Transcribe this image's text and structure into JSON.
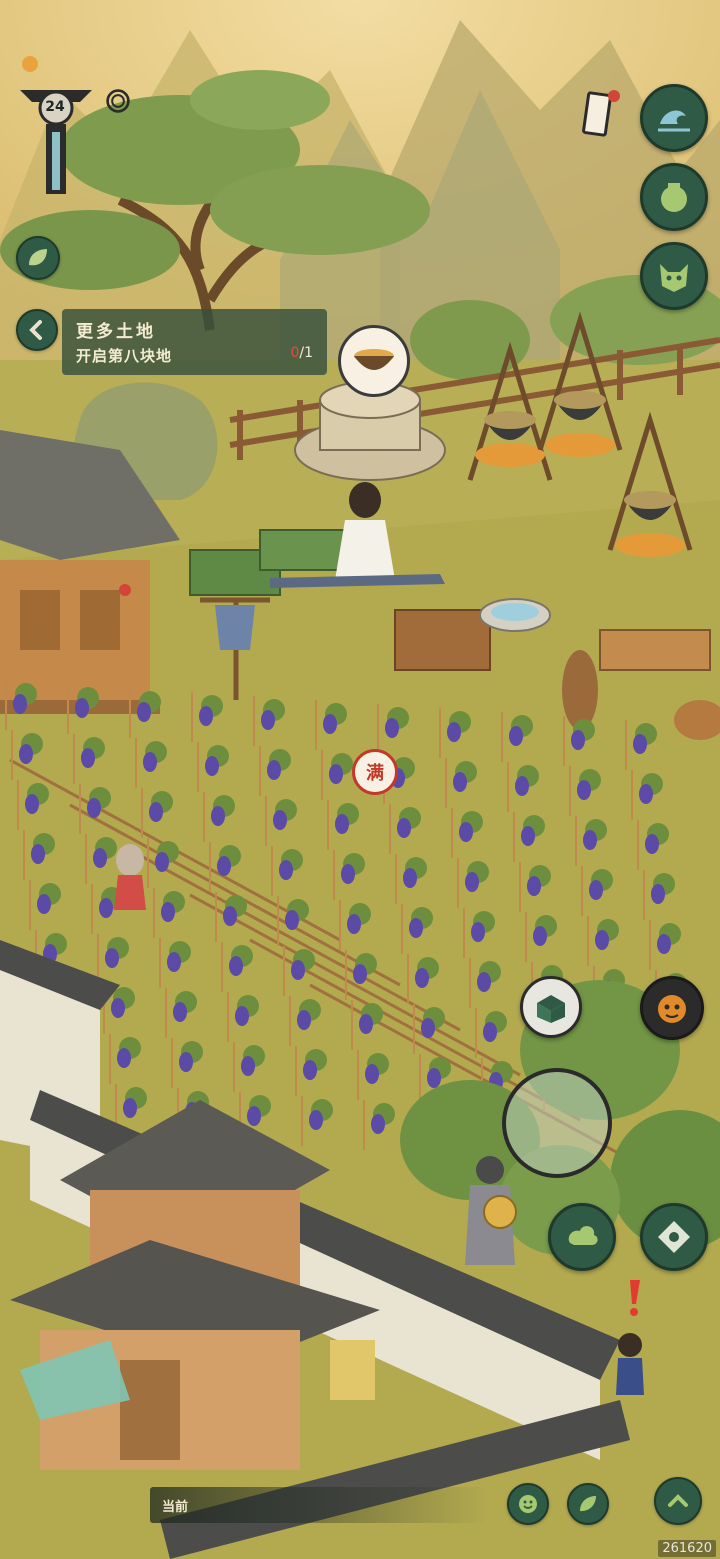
{
  "hud": {
    "level": "24",
    "quest": {
      "title": "更多土地",
      "description": "开启第八块地",
      "progress_done": "0",
      "progress_total": "/1"
    },
    "full_badge": "满",
    "chat_label": "当前",
    "version": "261620"
  },
  "icons": {
    "top_left": [
      "level-totem-icon",
      "spiral-icon",
      "leaf-icon",
      "back-arrow-icon"
    ],
    "right_column": [
      "scroll-icon",
      "wave-icon",
      "pot-icon",
      "demon-mask-icon"
    ],
    "action": [
      "chest-icon",
      "tiger-mask-icon",
      "cloud-icon",
      "shuriken-icon",
      "exclamation-icon"
    ],
    "bottom": [
      "emote-icon",
      "leaf-share-icon",
      "chevron-up-icon"
    ]
  },
  "colors": {
    "button_fill": "#2f5a45",
    "button_border": "#1d3a2c",
    "badge_red": "#c2392a",
    "panel": "#37503c",
    "grass": "#b9b25a",
    "grape": "#5b4aa6"
  }
}
